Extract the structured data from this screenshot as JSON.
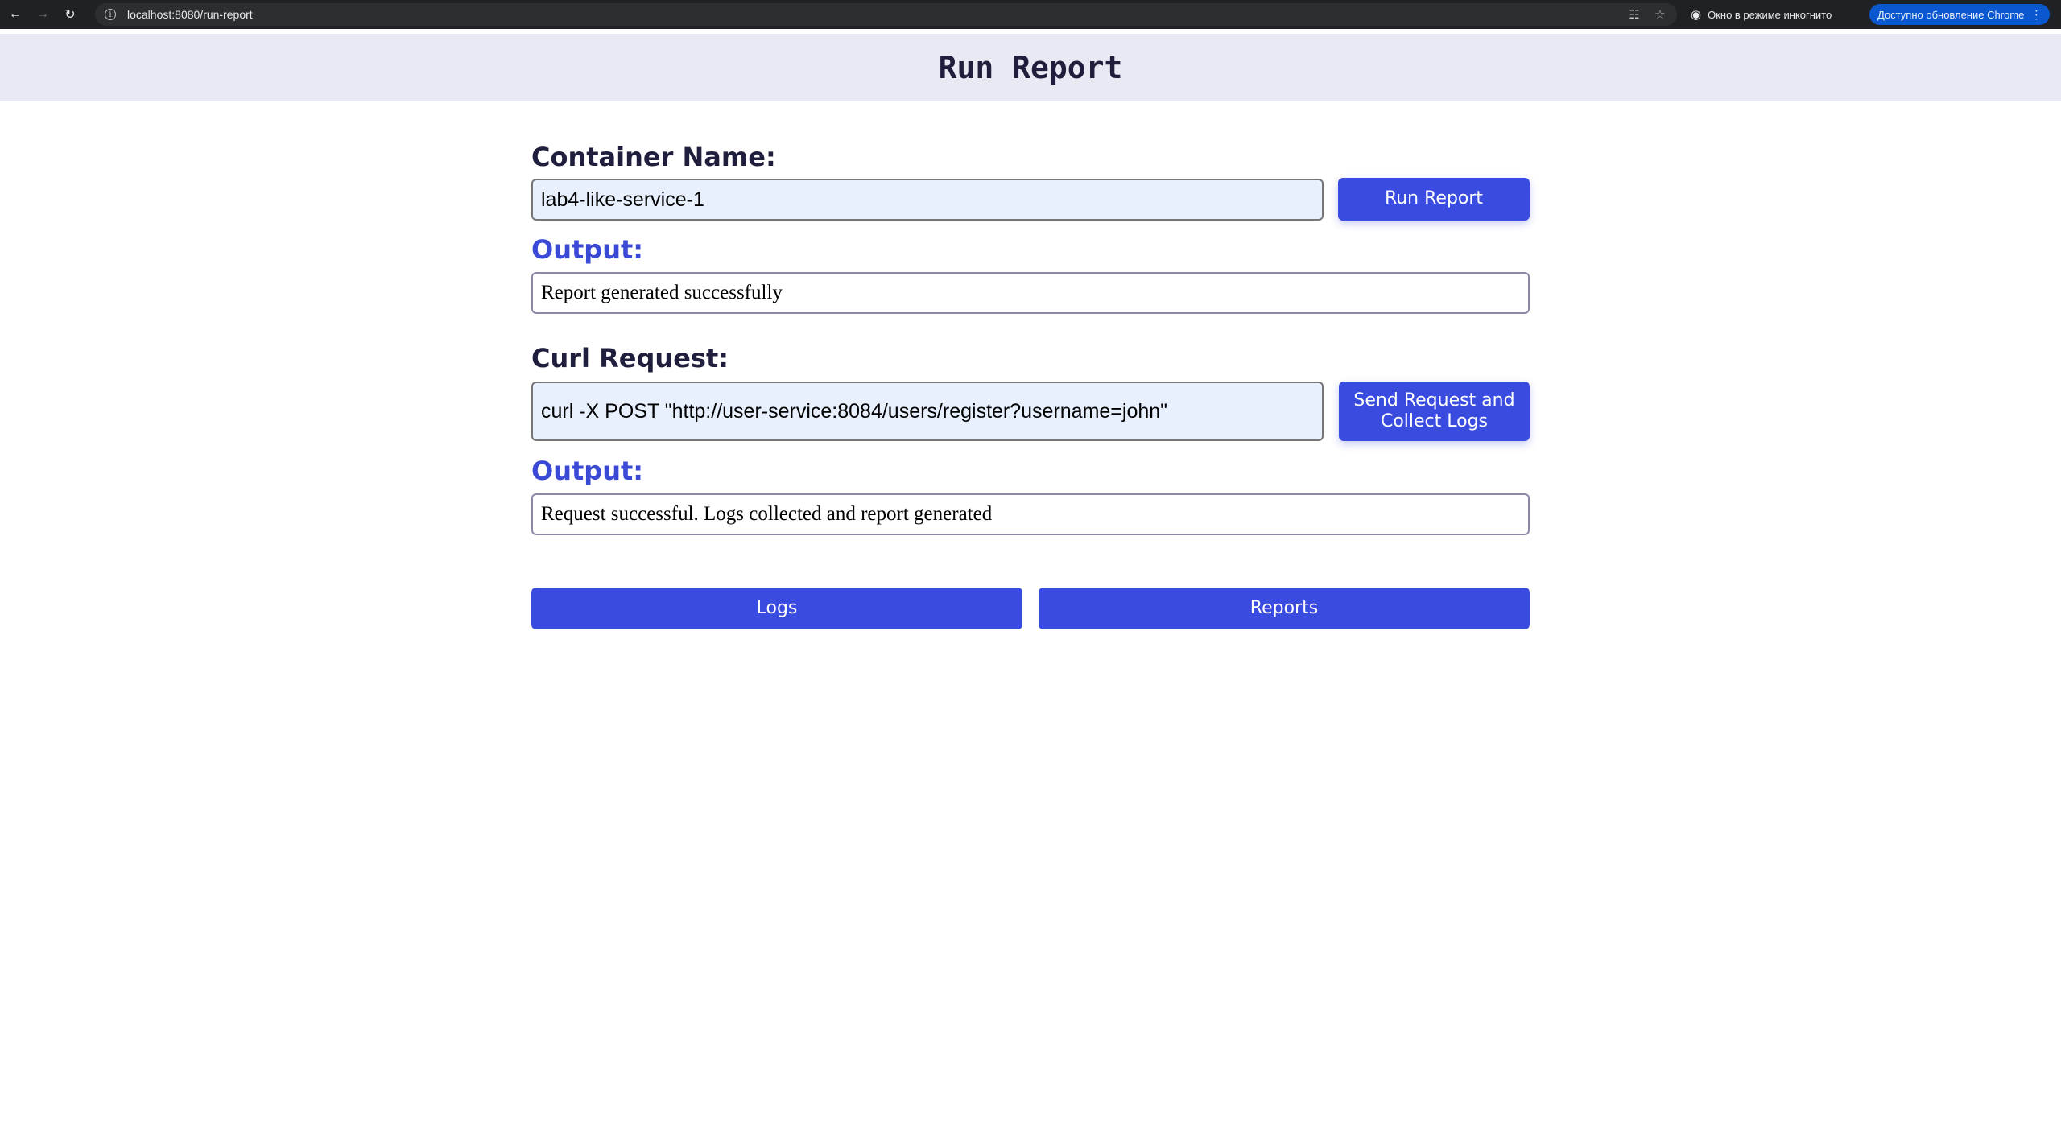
{
  "browser": {
    "url_host": "localhost",
    "url_rest": ":8080/run-report",
    "incognito_label": "Окно в режиме инкогнито",
    "update_label": "Доступно обновление Chrome"
  },
  "page": {
    "title": "Run Report"
  },
  "container_section": {
    "label": "Container Name:",
    "input_value": "lab4-like-service-1",
    "button_label": "Run Report",
    "output_label": "Output:",
    "output_value": "Report generated successfully"
  },
  "curl_section": {
    "label": "Curl Request:",
    "input_value": "curl -X POST \"http://user-service:8084/users/register?username=john\"",
    "button_label": "Send Request and Collect Logs",
    "output_label": "Output:",
    "output_value": "Request successful. Logs collected and report generated"
  },
  "footer_buttons": {
    "logs_label": "Logs",
    "reports_label": "Reports"
  }
}
